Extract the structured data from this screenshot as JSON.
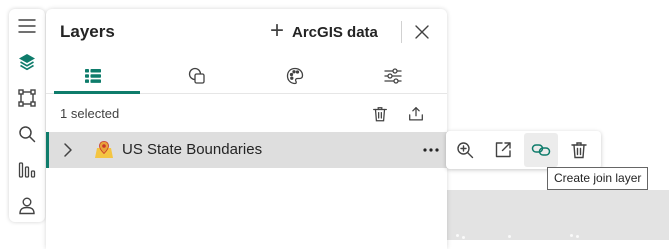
{
  "colors": {
    "accent": "#0e7c6b",
    "selected_row": "#dedede",
    "map": "#e3e3e3"
  },
  "rail": {
    "items": [
      {
        "name": "menu",
        "icon": "hamburger-menu-icon"
      },
      {
        "name": "layers",
        "icon": "layers-stack-icon",
        "active": true
      },
      {
        "name": "select",
        "icon": "selection-box-icon"
      },
      {
        "name": "search",
        "icon": "search-icon"
      },
      {
        "name": "analysis",
        "icon": "bar-chart-icon"
      },
      {
        "name": "account",
        "icon": "person-icon"
      }
    ]
  },
  "panel": {
    "title": "Layers",
    "add_data_label": "ArcGIS data",
    "add_data_icon": "plus-icon",
    "close_icon": "close-icon",
    "tabs": [
      {
        "name": "layer-list",
        "icon": "list-icon",
        "active": true
      },
      {
        "name": "basemap",
        "icon": "overlapping-shapes-icon"
      },
      {
        "name": "styles",
        "icon": "palette-icon"
      },
      {
        "name": "filters",
        "icon": "sliders-icon"
      }
    ],
    "selected_count_text": "1 selected",
    "selection_actions": [
      {
        "icon": "trash-icon"
      },
      {
        "icon": "share-upload-icon"
      }
    ],
    "layers": [
      {
        "name": "US State Boundaries",
        "icon": "map-pin-layer-icon",
        "selected": true
      }
    ]
  },
  "layer_actions": [
    {
      "name": "zoom-to",
      "icon": "zoom-in-icon"
    },
    {
      "name": "open",
      "icon": "open-external-icon"
    },
    {
      "name": "create-join-layer",
      "icon": "link-icon",
      "hover": true
    },
    {
      "name": "delete",
      "icon": "trash-icon"
    }
  ],
  "tooltip": {
    "text": "Create join layer"
  }
}
